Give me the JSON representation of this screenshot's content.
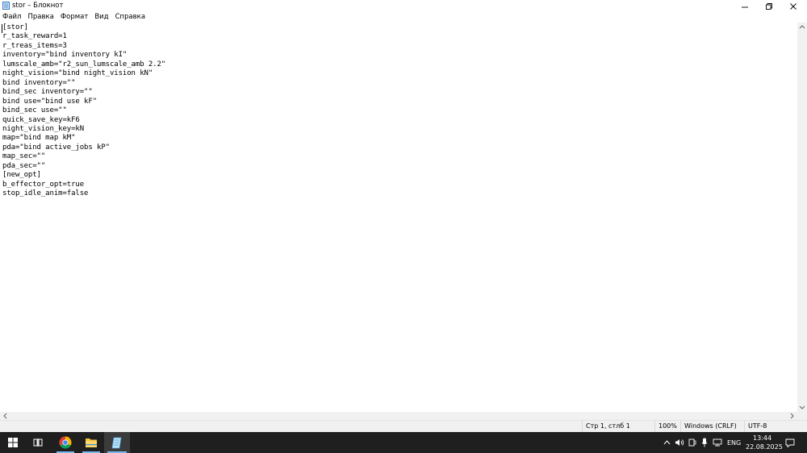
{
  "window": {
    "title": "stor – Блокнот",
    "icon": "notepad-icon"
  },
  "menu": [
    "Файл",
    "Правка",
    "Формат",
    "Вид",
    "Справка"
  ],
  "editor": {
    "lines": [
      "[stor]",
      "r_task_reward=1",
      "r_treas_items=3",
      "inventory=\"bind inventory kI\"",
      "lumscale_amb=\"r2_sun_lumscale_amb 2.2\"",
      "night_vision=\"bind night_vision kN\"",
      "bind inventory=\"\"",
      "bind_sec inventory=\"\"",
      "bind use=\"bind use kF\"",
      "bind_sec use=\"\"",
      "quick_save_key=kF6",
      "night_vision_key=kN",
      "map=\"bind map kM\"",
      "pda=\"bind active_jobs kP\"",
      "map_sec=\"\"",
      "pda_sec=\"\"",
      "[new_opt]",
      "b_effector_opt=true",
      "stop_idle_anim=false"
    ]
  },
  "status": {
    "position": "Стр 1, стлб 1",
    "zoom": "100%",
    "line_endings": "Windows (CRLF)",
    "encoding": "UTF-8"
  },
  "taskbar": {
    "apps": [
      {
        "name": "start-icon"
      },
      {
        "name": "task-view-icon"
      },
      {
        "name": "chrome-icon"
      },
      {
        "name": "file-explorer-icon"
      },
      {
        "name": "notepad-icon"
      }
    ],
    "tray": {
      "language": "ENG",
      "time": "13:44",
      "date": "22.08.2025"
    }
  },
  "colors": {
    "taskbar_bg": "#1f1f1f",
    "active_indicator": "#76b9ed",
    "statusbar_bg": "#f0f0f0"
  }
}
